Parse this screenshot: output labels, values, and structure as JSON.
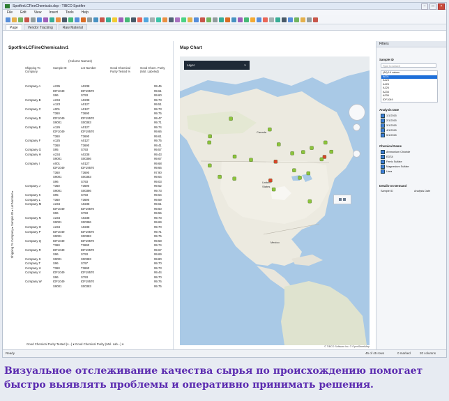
{
  "window": {
    "title": "SpotfireLCFineChemicals.dxp - TIBCO Spotfire"
  },
  "menu": [
    "File",
    "Edit",
    "View",
    "Insert",
    "Tools",
    "Help"
  ],
  "tabs": [
    "Page",
    "Vendor Tracking",
    "Raw Material"
  ],
  "table_panel": {
    "title": "SpotfireLCFineChemicalsv1",
    "column_names_label": "(Column Names)",
    "headers": [
      "Shipping To Company",
      "Sample ID",
      "Lot Number",
      "Good Chemical Purity Tested %",
      "Good Chem. Purity (Mol. Labeled)"
    ],
    "rows": [
      [
        "Company A",
        "A235",
        "A0238",
        "",
        "99.45"
      ],
      [
        "",
        "IDF1049",
        "IDF19570",
        "",
        "99.61"
      ],
      [
        "",
        "S96",
        "S793",
        "",
        "99.60"
      ],
      [
        "Company B",
        "A234",
        "A0238",
        "",
        "99.73"
      ],
      [
        "",
        "A123",
        "A0127",
        "",
        "99.51"
      ],
      [
        "Company C",
        "A001",
        "A0127",
        "",
        "99.73"
      ],
      [
        "",
        "T360",
        "T3690",
        "",
        "99.75"
      ],
      [
        "Company D",
        "IDF1049",
        "IDF19570",
        "",
        "99.47"
      ],
      [
        "",
        "S9001",
        "S00383",
        "",
        "99.71"
      ],
      [
        "Company E",
        "A126",
        "A0127",
        "",
        "99.74"
      ],
      [
        "",
        "IDF1049",
        "IDF19570",
        "",
        "99.66"
      ],
      [
        "",
        "T360",
        "T3690",
        "",
        "99.61"
      ],
      [
        "Company F",
        "A125",
        "A0127",
        "",
        "99.75"
      ],
      [
        "",
        "T360",
        "T3690",
        "",
        "99.41"
      ],
      [
        "Company G",
        "S95",
        "S793",
        "",
        "99.57"
      ],
      [
        "Company H",
        "A234",
        "A0238",
        "",
        "99.43"
      ],
      [
        "",
        "S9001",
        "S00386",
        "",
        "99.67"
      ],
      [
        "Company I",
        "A001",
        "A0127",
        "",
        "99.68"
      ],
      [
        "",
        "IDF1049",
        "IDF19570",
        "",
        "99.66"
      ],
      [
        "",
        "T360",
        "T3690",
        "",
        "97.90"
      ],
      [
        "",
        "S9001",
        "S00383",
        "",
        "99.64"
      ],
      [
        "",
        "S96",
        "S793",
        "",
        "99.03"
      ],
      [
        "Company J",
        "T360",
        "T3690",
        "",
        "99.62"
      ],
      [
        "",
        "S9001",
        "S00386",
        "",
        "99.73"
      ],
      [
        "Company K",
        "S95",
        "S793",
        "",
        "99.64"
      ],
      [
        "Company L",
        "T360",
        "T3690",
        "",
        "99.59"
      ],
      [
        "Company M",
        "A234",
        "A0238",
        "",
        "99.61"
      ],
      [
        "",
        "IDF1049",
        "IDF19570",
        "",
        "99.60"
      ],
      [
        "",
        "S96",
        "S793",
        "",
        "99.55"
      ],
      [
        "Company N",
        "A234",
        "A0238",
        "",
        "99.73"
      ],
      [
        "",
        "S9001",
        "S00386",
        "",
        "99.69"
      ],
      [
        "Company O",
        "A234",
        "A0238",
        "",
        "99.70"
      ],
      [
        "Company P",
        "IDF1049",
        "IDF19570",
        "",
        "99.71"
      ],
      [
        "",
        "S9001",
        "S00383",
        "",
        "99.75"
      ],
      [
        "Company Q",
        "IDF1049",
        "IDF19570",
        "",
        "99.58"
      ],
      [
        "",
        "T360",
        "T3690",
        "",
        "99.74"
      ],
      [
        "Company R",
        "IDF1049",
        "IDF19570",
        "",
        "99.67"
      ],
      [
        "",
        "S96",
        "S793",
        "",
        "99.69"
      ],
      [
        "Company S",
        "S9001",
        "S00383",
        "",
        "99.80"
      ],
      [
        "Company T",
        "S96",
        "S797",
        "",
        "99.70"
      ],
      [
        "Company U",
        "T360",
        "T3690",
        "",
        "99.73"
      ],
      [
        "Company V",
        "IDF1049",
        "IDF19570",
        "",
        "99.44"
      ],
      [
        "",
        "S96",
        "S793",
        "",
        "99.70"
      ],
      [
        "Company W",
        "IDF1049",
        "IDF19570",
        "",
        "99.76"
      ],
      [
        "",
        "S9001",
        "S00383",
        "",
        "99.75"
      ]
    ],
    "vertical_axis_label": "Shipping To Company ▸ Sample ID ▸ Lot Number ▸",
    "footer": "Good Chemical Purity Tested (s...) ▾   Good Chemical Purity (Mol. Lab...) ▾"
  },
  "map_panel": {
    "title": "Map Chart",
    "layer_selector": "Layer",
    "copyright": "© TIBCO Software Inc. © OpenStreetMap"
  },
  "filters": {
    "header": "Filters",
    "sample_id_label": "Sample ID",
    "search_placeholder": "Type to search",
    "sample_ids": [
      "(All) 14 values",
      "A001",
      "A123",
      "A125",
      "A126",
      "A234",
      "A235",
      "IDF1049"
    ],
    "analysis_date_label": "Analysis Date",
    "analysis_dates": [
      "1/1/2015",
      "2/1/2015",
      "3/1/2015",
      "4/1/2015",
      "5/1/2015"
    ],
    "chemical_name_label": "Chemical Name",
    "chemical_names": [
      "Ammonium Chloride",
      "EDTA",
      "Ferric Sulfate",
      "Magnesium Sulfate",
      "Urea"
    ],
    "details_label": "Details-on-Demand",
    "details_cols": [
      "Sample ID",
      "Analysis Date"
    ]
  },
  "status": {
    "left": "Ready",
    "rows": "45 of 45 rows",
    "marked": "0 marked",
    "col": "20 columns"
  },
  "caption": {
    "line1": "Визуальное отслеживание качества сырья по происхождению помогает",
    "line2": "быстро выявлять проблемы и оперативно принимать решения."
  },
  "map_markers": [
    {
      "lat": 47.6,
      "lon": -122.3,
      "color": "#8cc43c"
    },
    {
      "lat": 45.5,
      "lon": -122.6,
      "color": "#8cc43c"
    },
    {
      "lat": 37.8,
      "lon": -122.4,
      "color": "#8cc43c"
    },
    {
      "lat": 34.0,
      "lon": -118.2,
      "color": "#8cc43c"
    },
    {
      "lat": 33.4,
      "lon": -112.0,
      "color": "#8cc43c"
    },
    {
      "lat": 39.7,
      "lon": -105.0,
      "color": "#8cc43c"
    },
    {
      "lat": 40.8,
      "lon": -111.9,
      "color": "#8cc43c"
    },
    {
      "lat": 32.8,
      "lon": -96.8,
      "color": "#d9442b"
    },
    {
      "lat": 29.8,
      "lon": -95.4,
      "color": "#8cc43c"
    },
    {
      "lat": 41.9,
      "lon": -87.6,
      "color": "#8cc43c"
    },
    {
      "lat": 44.9,
      "lon": -93.3,
      "color": "#8cc43c"
    },
    {
      "lat": 39.1,
      "lon": -94.6,
      "color": "#d9442b"
    },
    {
      "lat": 36.2,
      "lon": -86.8,
      "color": "#8cc43c"
    },
    {
      "lat": 33.7,
      "lon": -84.4,
      "color": "#8cc43c"
    },
    {
      "lat": 42.3,
      "lon": -83.0,
      "color": "#8cc43c"
    },
    {
      "lat": 40.7,
      "lon": -74.0,
      "color": "#d9442b"
    },
    {
      "lat": 42.4,
      "lon": -71.1,
      "color": "#8cc43c"
    },
    {
      "lat": 39.9,
      "lon": -75.2,
      "color": "#8cc43c"
    },
    {
      "lat": 35.2,
      "lon": -80.8,
      "color": "#8cc43c"
    },
    {
      "lat": 43.7,
      "lon": -79.4,
      "color": "#8cc43c"
    },
    {
      "lat": 45.5,
      "lon": -73.6,
      "color": "#8cc43c"
    },
    {
      "lat": 53.5,
      "lon": -113.5,
      "color": "#8cc43c"
    },
    {
      "lat": 49.9,
      "lon": -97.1,
      "color": "#8cc43c"
    },
    {
      "lat": 25.8,
      "lon": -80.2,
      "color": "#8cc43c"
    }
  ]
}
